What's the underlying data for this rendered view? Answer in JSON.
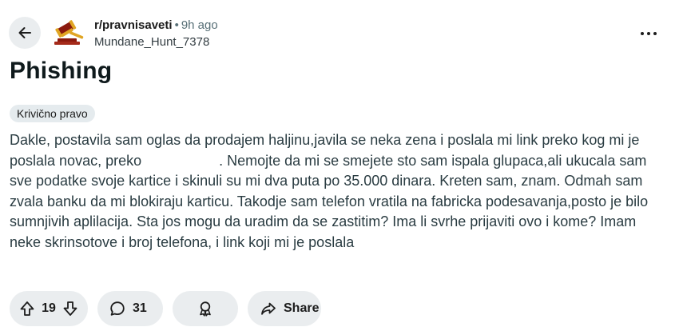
{
  "post": {
    "subreddit": "r/pravnisaveti",
    "separator": "•",
    "age": "9h ago",
    "author": "Mundane_Hunt_7378",
    "title": "Phishing",
    "flair": "Krivično pravo",
    "body_part1": "Dakle, postavila sam oglas da prodajem haljinu,javila se neka zena i poslala mi link preko kog mi je poslala novac, preko",
    "body_part2": ". Nemojte da mi se smejete sto sam ispala glupaca,ali ukucala sam sve podatke svoje kartice i skinuli su mi dva puta po 35.000 dinara. Kreten sam, znam. Odmah sam zvala banku da mi blokiraju karticu. Takodje sam telefon vratila na fabricka podesavanja,posto je bilo sumnjivih aplilacija. Sta jos mogu da uradim da se zastitim? Ima li svrhe prijaviti ovo i kome? Imam neke skrinsotove i broj telefona, i link koji mi je poslala"
  },
  "actions": {
    "score": "19",
    "comments": "31",
    "share_label": "Share"
  },
  "icons": {
    "back": "arrow-left-icon",
    "avatar": "gavel-icon",
    "more": "more-horizontal-icon",
    "upvote": "arrow-up-icon",
    "downvote": "arrow-down-icon",
    "comments": "comment-bubble-icon",
    "award": "award-icon",
    "share": "share-arrow-icon"
  }
}
